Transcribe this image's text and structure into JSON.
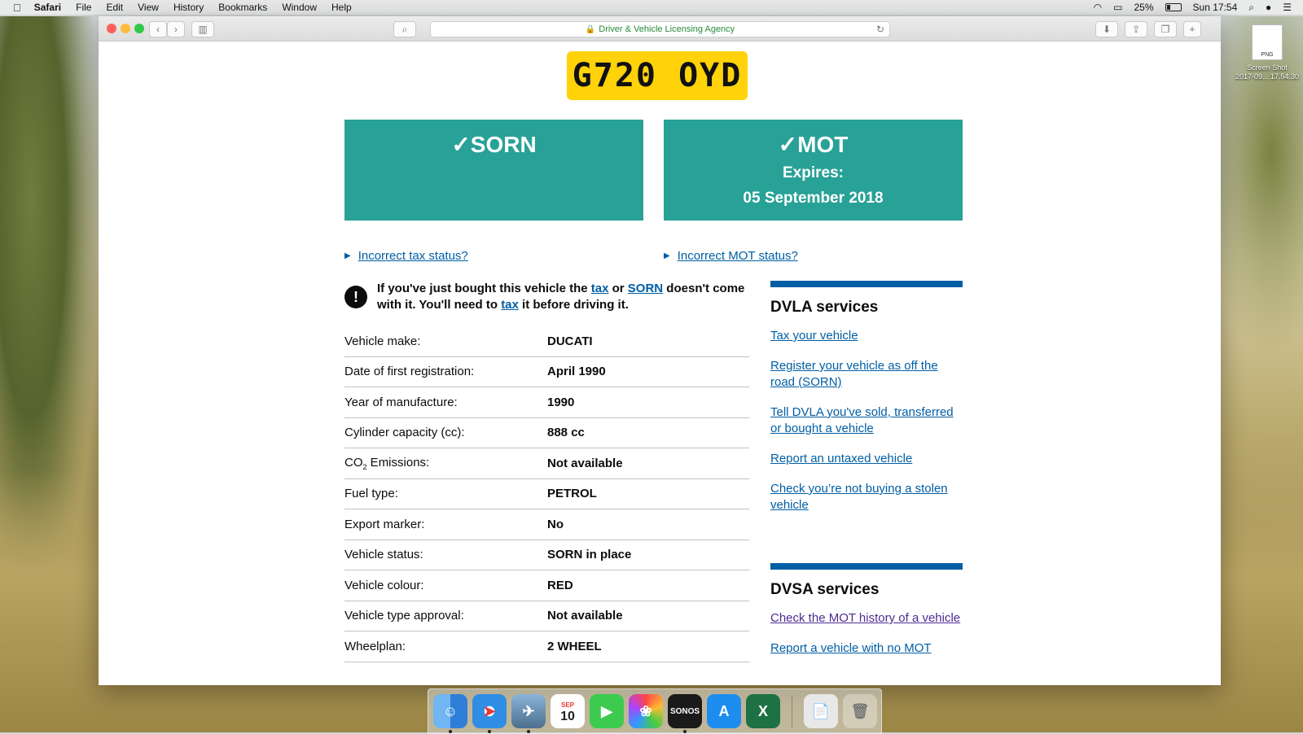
{
  "menubar": {
    "app": "Safari",
    "items": [
      "File",
      "Edit",
      "View",
      "History",
      "Bookmarks",
      "Window",
      "Help"
    ],
    "battery": "25%",
    "clock": "Sun 17:54"
  },
  "browser": {
    "address": "Driver & Vehicle Licensing Agency"
  },
  "vehicle": {
    "registration": "G720 OYD",
    "tax_panel": {
      "title": "✓SORN"
    },
    "mot_panel": {
      "title": "✓MOT",
      "expires_label": "Expires:",
      "expires_date": "05 September 2018"
    },
    "incorrect_tax": "Incorrect tax status?",
    "incorrect_mot": "Incorrect MOT status?",
    "warning": {
      "part1": "If you've just bought this vehicle the ",
      "link_tax": "tax",
      "part2": " or ",
      "link_sorn": "SORN",
      "part3": " doesn't come with it. You'll need to ",
      "link_tax2": "tax",
      "part4": " it before driving it."
    },
    "details": [
      {
        "label": "Vehicle make:",
        "value": "DUCATI"
      },
      {
        "label": "Date of first registration:",
        "value": "April 1990"
      },
      {
        "label": "Year of manufacture:",
        "value": "1990"
      },
      {
        "label": "Cylinder capacity (cc):",
        "value": "888 cc"
      },
      {
        "label": "CO",
        "label_sub": "2",
        "label_rest": " Emissions:",
        "value": "Not available"
      },
      {
        "label": "Fuel type:",
        "value": "PETROL"
      },
      {
        "label": "Export marker:",
        "value": "No"
      },
      {
        "label": "Vehicle status:",
        "value": "SORN in place"
      },
      {
        "label": "Vehicle colour:",
        "value": "RED"
      },
      {
        "label": "Vehicle type approval:",
        "value": "Not available"
      },
      {
        "label": "Wheelplan:",
        "value": "2 WHEEL"
      }
    ]
  },
  "dvla_services": {
    "title": "DVLA services",
    "links": [
      "Tax your vehicle",
      "Register your vehicle as off the road (SORN)",
      "Tell DVLA you've sold, transferred or bought a vehicle",
      "Report an untaxed vehicle",
      "Check you’re not buying a stolen vehicle"
    ]
  },
  "dvsa_services": {
    "title": "DVSA services",
    "links": [
      "Check the MOT history of a vehicle",
      "Report a vehicle with no MOT"
    ]
  },
  "desktop_file": {
    "type": "PNG",
    "name": "Screen Shot",
    "date": "2017-09... 17.54.30"
  },
  "dock": {
    "calendar_month": "SEP",
    "calendar_day": "10",
    "sonos": "SONOS"
  },
  "colors": {
    "gov_blue": "#005ea5",
    "panel_green": "#28a197",
    "plate_yellow": "#ffd20a"
  }
}
